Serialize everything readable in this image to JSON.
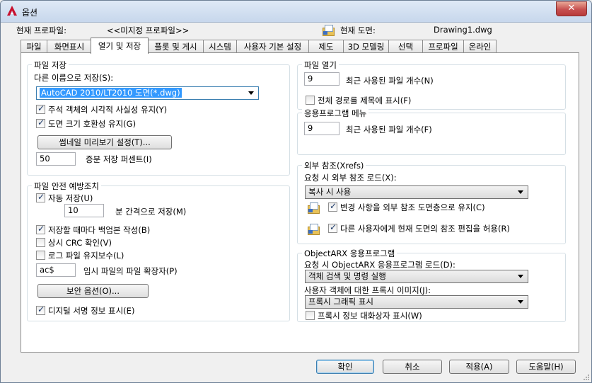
{
  "window": {
    "title": "옵션",
    "close": "✕"
  },
  "header": {
    "profile_label": "현재 프로파일:",
    "profile_value": "<<미지정 프로파일>>",
    "drawing_label": "현재 도면:",
    "drawing_value": "Drawing1.dwg"
  },
  "tabs": [
    "파일",
    "화면표시",
    "열기 및 저장",
    "플롯 및 게시",
    "시스템",
    "사용자 기본 설정",
    "제도",
    "3D 모델링",
    "선택",
    "프로파일",
    "온라인"
  ],
  "file_save": {
    "title": "파일 저장",
    "save_as_label": "다른 이름으로 저장(S):",
    "save_as_value": "AutoCAD 2010/LT2010 도면(*.dwg)",
    "annot_visual": {
      "label": "주석 객체의 시각적 사실성 유지(Y)",
      "checked": true
    },
    "drawing_size": {
      "label": "도면 크기 호환성 유지(G)",
      "checked": true
    },
    "thumb_button": "썸네일 미리보기 설정(T)...",
    "incremental_value": "50",
    "incremental_label": "증분 저장 퍼센트(I)"
  },
  "file_safety": {
    "title": "파일 안전 예방조치",
    "autosave": {
      "label": "자동 저장(U)",
      "checked": true
    },
    "interval_value": "10",
    "interval_label": "분 간격으로 저장(M)",
    "backup": {
      "label": "저장할 때마다 백업본 작성(B)",
      "checked": true
    },
    "crc": {
      "label": "상시 CRC 확인(V)",
      "checked": false
    },
    "log": {
      "label": "로그 파일 유지보수(L)",
      "checked": false
    },
    "temp_ext_value": "ac$",
    "temp_ext_label": "임시 파일의 파일 확장자(P)",
    "security_button": "보안 옵션(O)...",
    "digital_sig": {
      "label": "디지털 서명 정보 표시(E)",
      "checked": true
    }
  },
  "file_open": {
    "title": "파일 열기",
    "recent_value": "9",
    "recent_label": "최근 사용된 파일 개수(N)",
    "full_path": {
      "label": "전체 경로를 제목에 표시(F)",
      "checked": false
    }
  },
  "app_menu": {
    "title": "응용프로그램 메뉴",
    "recent_value": "9",
    "recent_label": "최근 사용된 파일 개수(F)"
  },
  "xrefs": {
    "title": "외부 참조(Xrefs)",
    "demand_label": "요청 시 외부 참조 로드(X):",
    "demand_value": "복사 시 사용",
    "retain_changes": {
      "label": "변경 사항을 외부 참조 도면층으로 유지(C)",
      "checked": true
    },
    "allow_edit": {
      "label": "다른 사용자에게 현재 도면의 참조 편집을 허용(R)",
      "checked": true
    }
  },
  "objectarx": {
    "title": "ObjectARX 응용프로그램",
    "demand_label": "요청 시 ObjectARX 응용프로그램 로드(D):",
    "demand_value": "객체 검색 및 명령 실행",
    "proxy_label": "사용자 객체에 대한 프록시 이미지(J):",
    "proxy_value": "프록시 그래픽 표시",
    "proxy_dialog": {
      "label": "프록시 정보 대화상자 표시(W)",
      "checked": false
    }
  },
  "buttons": {
    "ok": "확인",
    "cancel": "취소",
    "apply": "적용(A)",
    "help": "도움말(H)"
  },
  "colors": {
    "accent": "#3c7fb1",
    "selection": "#3399ff",
    "title_bar": "#c7d7ec"
  }
}
